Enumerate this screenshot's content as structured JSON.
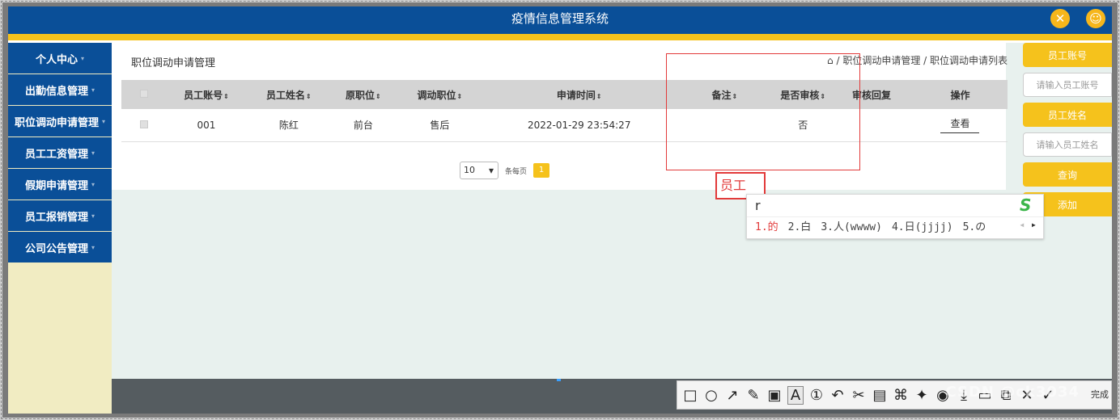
{
  "header": {
    "title": "疫情信息管理系统",
    "icons": [
      "close-icon",
      "user-icon"
    ]
  },
  "sidebar": {
    "items": [
      {
        "label": "个人中心"
      },
      {
        "label": "出勤信息管理"
      },
      {
        "label": "职位调动申请管理"
      },
      {
        "label": "员工工资管理"
      },
      {
        "label": "假期申请管理"
      },
      {
        "label": "员工报销管理"
      },
      {
        "label": "公司公告管理"
      }
    ]
  },
  "main": {
    "title": "职位调动申请管理",
    "breadcrumb": "/ 职位调动申请管理 / 职位调动申请列表",
    "table": {
      "headers": [
        "员工账号",
        "员工姓名",
        "原职位",
        "调动职位",
        "申请时间",
        "备注",
        "是否审核",
        "审核回复",
        "操作"
      ],
      "rows": [
        {
          "account": "001",
          "name": "陈红",
          "orig": "前台",
          "target": "售后",
          "time": "2022-01-29 23:54:27",
          "note": "",
          "reviewed": "否",
          "reply": "",
          "action": "查看"
        }
      ]
    },
    "pager": {
      "page_size": "10",
      "per_page_label": "条每页",
      "current": "1"
    }
  },
  "search_panel": {
    "account_label": "员工账号",
    "account_placeholder": "请输入员工账号",
    "name_label": "员工姓名",
    "name_placeholder": "请输入员工姓名",
    "query_label": "查询",
    "add_label": "添加"
  },
  "ime": {
    "typed": "员工",
    "composition": "r",
    "candidates": [
      "1.的",
      "2.白",
      "3.人(wwww)",
      "4.日(jjjj)",
      "5.の"
    ]
  },
  "toolbar": {
    "done_label": "完成"
  },
  "watermark": "CSDN @ck3034"
}
